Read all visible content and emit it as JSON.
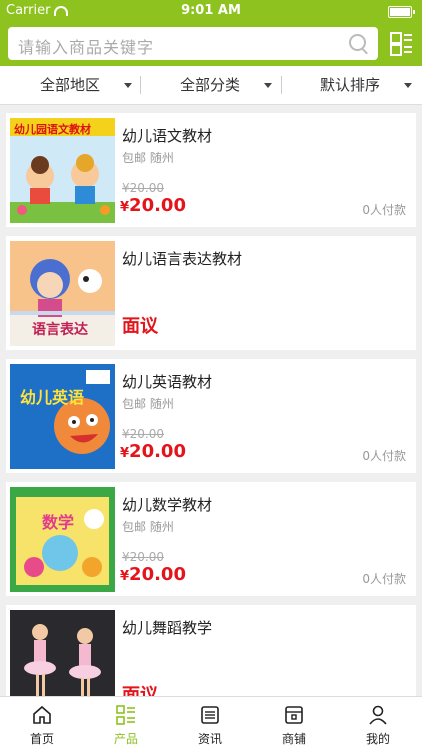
{
  "status_bar": {
    "carrier": "Carrier",
    "time": "9:01 AM"
  },
  "search": {
    "placeholder": "请输入商品关键字"
  },
  "filters": {
    "region": "全部地区",
    "category": "全部分类",
    "sort": "默认排序"
  },
  "products": [
    {
      "name": "幼儿语文教材",
      "shipping": "包邮 随州",
      "original_price": "¥20.00",
      "currency": "¥",
      "price": "20.00",
      "buyers": "0人付款",
      "cover_title": "幼儿园语文教材"
    },
    {
      "name": "幼儿语言表达教材",
      "negotiable": "面议",
      "cover_title": "语言表达"
    },
    {
      "name": "幼儿英语教材",
      "shipping": "包邮 随州",
      "original_price": "¥20.00",
      "currency": "¥",
      "price": "20.00",
      "buyers": "0人付款",
      "cover_title": "幼儿英语"
    },
    {
      "name": "幼儿数学教材",
      "shipping": "包邮 随州",
      "original_price": "¥20.00",
      "currency": "¥",
      "price": "20.00",
      "buyers": "0人付款",
      "cover_title": "数学"
    },
    {
      "name": "幼儿舞蹈教学",
      "negotiable": "面议"
    }
  ],
  "tabbar": [
    {
      "label": "首页",
      "icon": "home-icon"
    },
    {
      "label": "产品",
      "icon": "grid-list-icon",
      "active": true
    },
    {
      "label": "资讯",
      "icon": "news-icon"
    },
    {
      "label": "商铺",
      "icon": "shop-icon"
    },
    {
      "label": "我的",
      "icon": "user-icon"
    }
  ],
  "colors": {
    "brand": "#8dc21f",
    "price": "#e4141b"
  }
}
